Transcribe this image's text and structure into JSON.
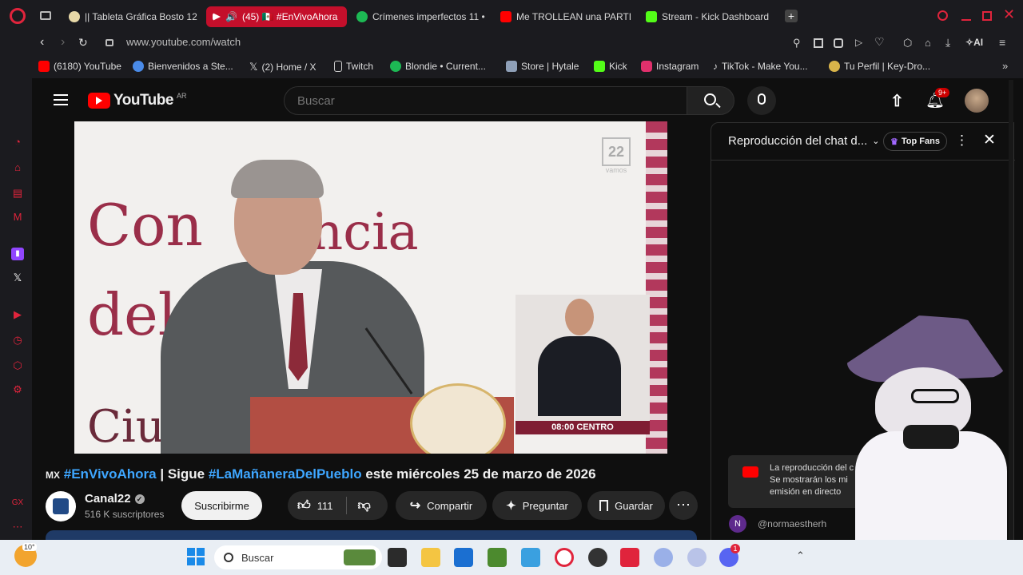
{
  "tabs": [
    {
      "label": "|| Tableta Gráfica Bosto 12",
      "color": "#e8d9a8"
    },
    {
      "label": "(45) 🇲🇽 #EnVivoAhora",
      "color": "#ffffff"
    },
    {
      "label": "Crímenes imperfectos 11 •",
      "color": "#1db954"
    },
    {
      "label": "Me TROLLEAN una PARTI",
      "color": "#ff0000"
    },
    {
      "label": "Stream - Kick Dashboard",
      "color": "#53fc18"
    }
  ],
  "address": {
    "url": "www.youtube.com/watch",
    "ai_label": "AI"
  },
  "bookmarks": [
    {
      "label": "(6180) YouTube",
      "color": "#ff0000"
    },
    {
      "label": "Bienvenidos a Ste...",
      "color": "#4a8be8"
    },
    {
      "label": "(2) Home / X",
      "color": "#ffffff"
    },
    {
      "label": "Twitch",
      "color": "#cccccc"
    },
    {
      "label": "Blondie • Current...",
      "color": "#1db954"
    },
    {
      "label": "Store | Hytale",
      "color": "#8fa0b8"
    },
    {
      "label": "Kick",
      "color": "#53fc18"
    },
    {
      "label": "Instagram",
      "color": "#e1306c"
    },
    {
      "label": "TikTok - Make You...",
      "color": "#ffffff"
    },
    {
      "label": "Tu Perfil | Key-Dro...",
      "color": "#d9b44a"
    }
  ],
  "youtube": {
    "logo": "YouTube",
    "region": "AR",
    "search_placeholder": "Buscar",
    "notif_count": "9+",
    "video": {
      "backdrop_line1": "Con",
      "backdrop_line1b": "ncia",
      "backdrop_line2": "del",
      "backdrop_line3": "Ciud",
      "watermark": "22",
      "watermark_sub": "vamos",
      "interpreter_caption": "08:00  CENTRO"
    },
    "title_prefix": "MX",
    "title_tag1": "#EnVivoAhora",
    "title_mid": " | Sigue ",
    "title_tag2": "#LaMañaneraDelPueblo",
    "title_suffix": " este miércoles 25 de marzo de 2026",
    "channel": {
      "name": "Canal22",
      "subs": "516 K suscriptores"
    },
    "subscribe": "Suscribirme",
    "likes": "111",
    "share": "Compartir",
    "ask": "Preguntar",
    "save": "Guardar"
  },
  "chat": {
    "title": "Reproducción del chat d...",
    "top_fans": "Top Fans",
    "notice_line1": "La reproducción del c",
    "notice_line2": "Se mostrarán los mi",
    "notice_line3": "emisión en directo",
    "user_initial": "N",
    "user_name": "@normaestherh"
  },
  "taskbar": {
    "weather": "10°",
    "search": "Buscar",
    "discord_badge": "1"
  },
  "colors": {
    "accent": "#c40f2b",
    "youtube_red": "#ff0000",
    "link_blue": "#3ea6ff"
  }
}
